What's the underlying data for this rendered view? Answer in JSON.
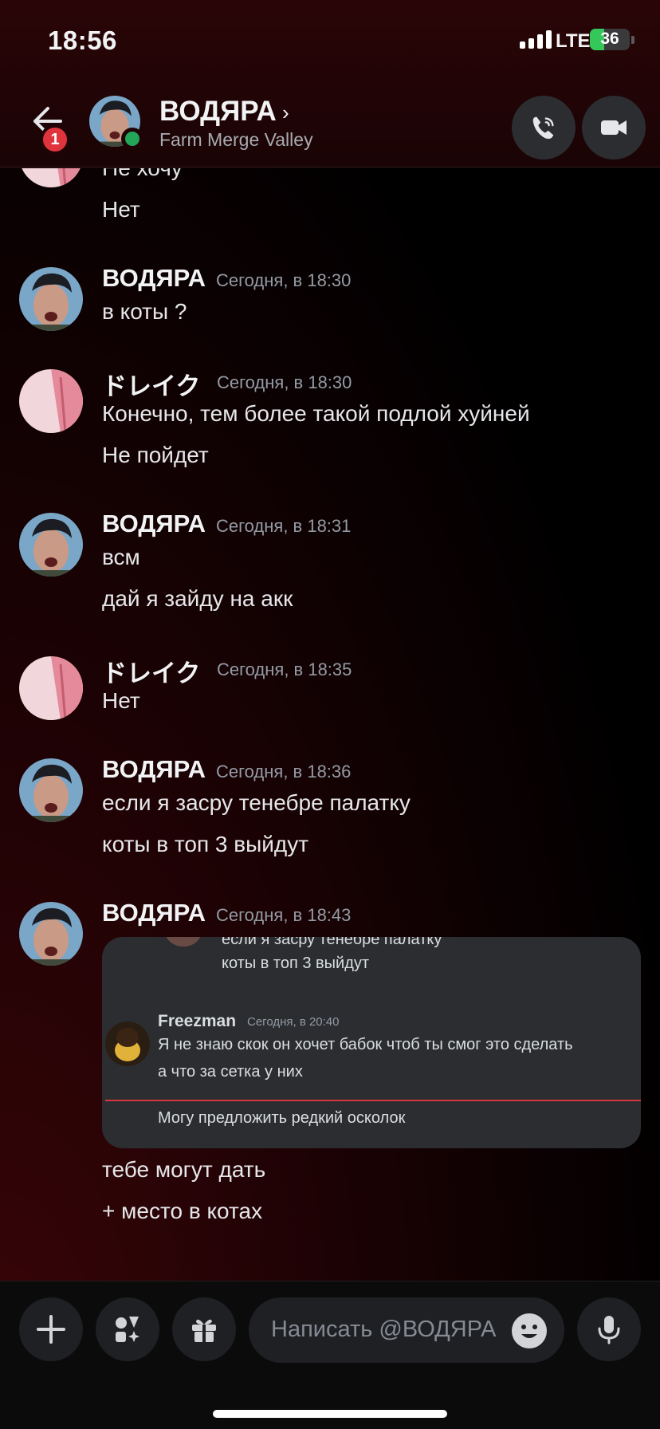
{
  "status": {
    "time": "18:56",
    "network": "LTE",
    "battery": "36",
    "battery_level": 0.36
  },
  "header": {
    "back_badge": "1",
    "name": "ВОДЯРА",
    "chevron": "›",
    "subtitle": "Farm Merge Valley",
    "icons": [
      "back-arrow-icon",
      "phone-icon",
      "video-camera-icon"
    ]
  },
  "messages": {
    "partial_top": [
      "Не хочу",
      "Нет"
    ],
    "groups": [
      {
        "author": "ВОДЯРА",
        "timestamp": "Сегодня, в 18:30",
        "lines": [
          "в коты ?"
        ]
      },
      {
        "author": "ドレイク",
        "timestamp": "Сегодня, в 18:30",
        "lines": [
          "Конечно, тем более такой подлой хуйней",
          "Не пойдет"
        ]
      },
      {
        "author": "ВОДЯРА",
        "timestamp": "Сегодня, в 18:31",
        "lines": [
          "всм",
          "дай я зайду на акк"
        ]
      },
      {
        "author": "ドレイク",
        "timestamp": "Сегодня, в 18:35",
        "lines": [
          "Нет"
        ]
      },
      {
        "author": "ВОДЯРА",
        "timestamp": "Сегодня, в 18:36",
        "lines": [
          "если я засру тенебре палатку",
          "коты в топ 3 выйдут"
        ]
      },
      {
        "author": "ВОДЯРА",
        "timestamp": "Сегодня, в 18:43",
        "lines": [
          "тебе могут дать",
          "+ место в котах"
        ]
      }
    ],
    "attachment": {
      "line1": "если я засру тенебре палатку",
      "line2": "коты в топ 3 выйдут",
      "author": "Freezman",
      "timestamp": "Сегодня, в 20:40",
      "text1": "Я не знаю скок он хочет бабок чтоб ты смог это сделать",
      "text2": "а что за сетка у них",
      "text3": "Могу предложить редкий осколок"
    }
  },
  "composer": {
    "placeholder": "Написать @ВОДЯРА",
    "icons": [
      "plus-icon",
      "apps-icon",
      "gift-icon",
      "emoji-icon",
      "microphone-icon"
    ]
  },
  "colors": {
    "accent_online": "#23a55a",
    "badge": "#e0343c",
    "battery_green": "#34c759"
  }
}
